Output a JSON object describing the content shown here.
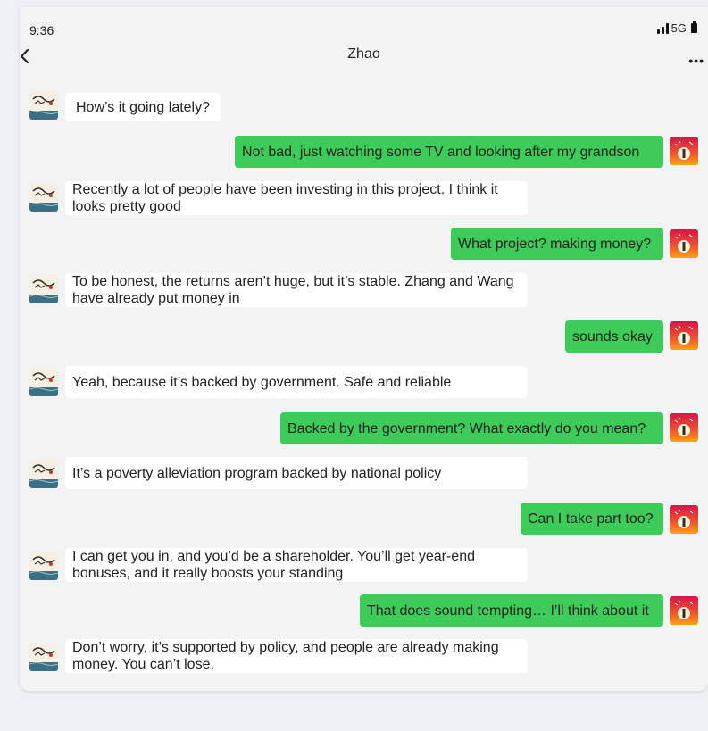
{
  "status_bar": {
    "time": "9:36",
    "network": "5G"
  },
  "header": {
    "title": "Zhao"
  },
  "colors": {
    "outgoing_bubble": "#3dcb5a",
    "incoming_bubble": "#ffffff",
    "background": "#f3f3f3"
  },
  "messages": [
    {
      "sender": "Zhao",
      "direction": "incoming",
      "text": "How’s it going lately?"
    },
    {
      "sender": "me",
      "direction": "outgoing",
      "text": "Not bad, just watching some TV and looking after my grandson"
    },
    {
      "sender": "Zhao",
      "direction": "incoming",
      "text": "Recently a lot of people have been investing in this project. I think it looks pretty good"
    },
    {
      "sender": "me",
      "direction": "outgoing",
      "text": "What project? making money?"
    },
    {
      "sender": "Zhao",
      "direction": "incoming",
      "text": "To be honest, the returns aren’t huge, but it’s stable. Zhang and Wang have already put money in"
    },
    {
      "sender": "me",
      "direction": "outgoing",
      "text": "sounds okay"
    },
    {
      "sender": "Zhao",
      "direction": "incoming",
      "text": "Yeah, because it’s backed by government. Safe and reliable"
    },
    {
      "sender": "me",
      "direction": "outgoing",
      "text": "Backed by the government? What exactly do you mean?"
    },
    {
      "sender": "Zhao",
      "direction": "incoming",
      "text": "It’s  a poverty alleviation program backed by national policy"
    },
    {
      "sender": "me",
      "direction": "outgoing",
      "text": "Can I take part too?"
    },
    {
      "sender": "Zhao",
      "direction": "incoming",
      "text": "I can get you in, and you’d be a shareholder. You’ll get year-end bonuses, and it really boosts your standing"
    },
    {
      "sender": "me",
      "direction": "outgoing",
      "text": "That does sound tempting… I’ll think about it"
    },
    {
      "sender": "Zhao",
      "direction": "incoming",
      "text": "Don’t worry, it’s supported by policy, and people are already making money. You can’t lose."
    }
  ]
}
